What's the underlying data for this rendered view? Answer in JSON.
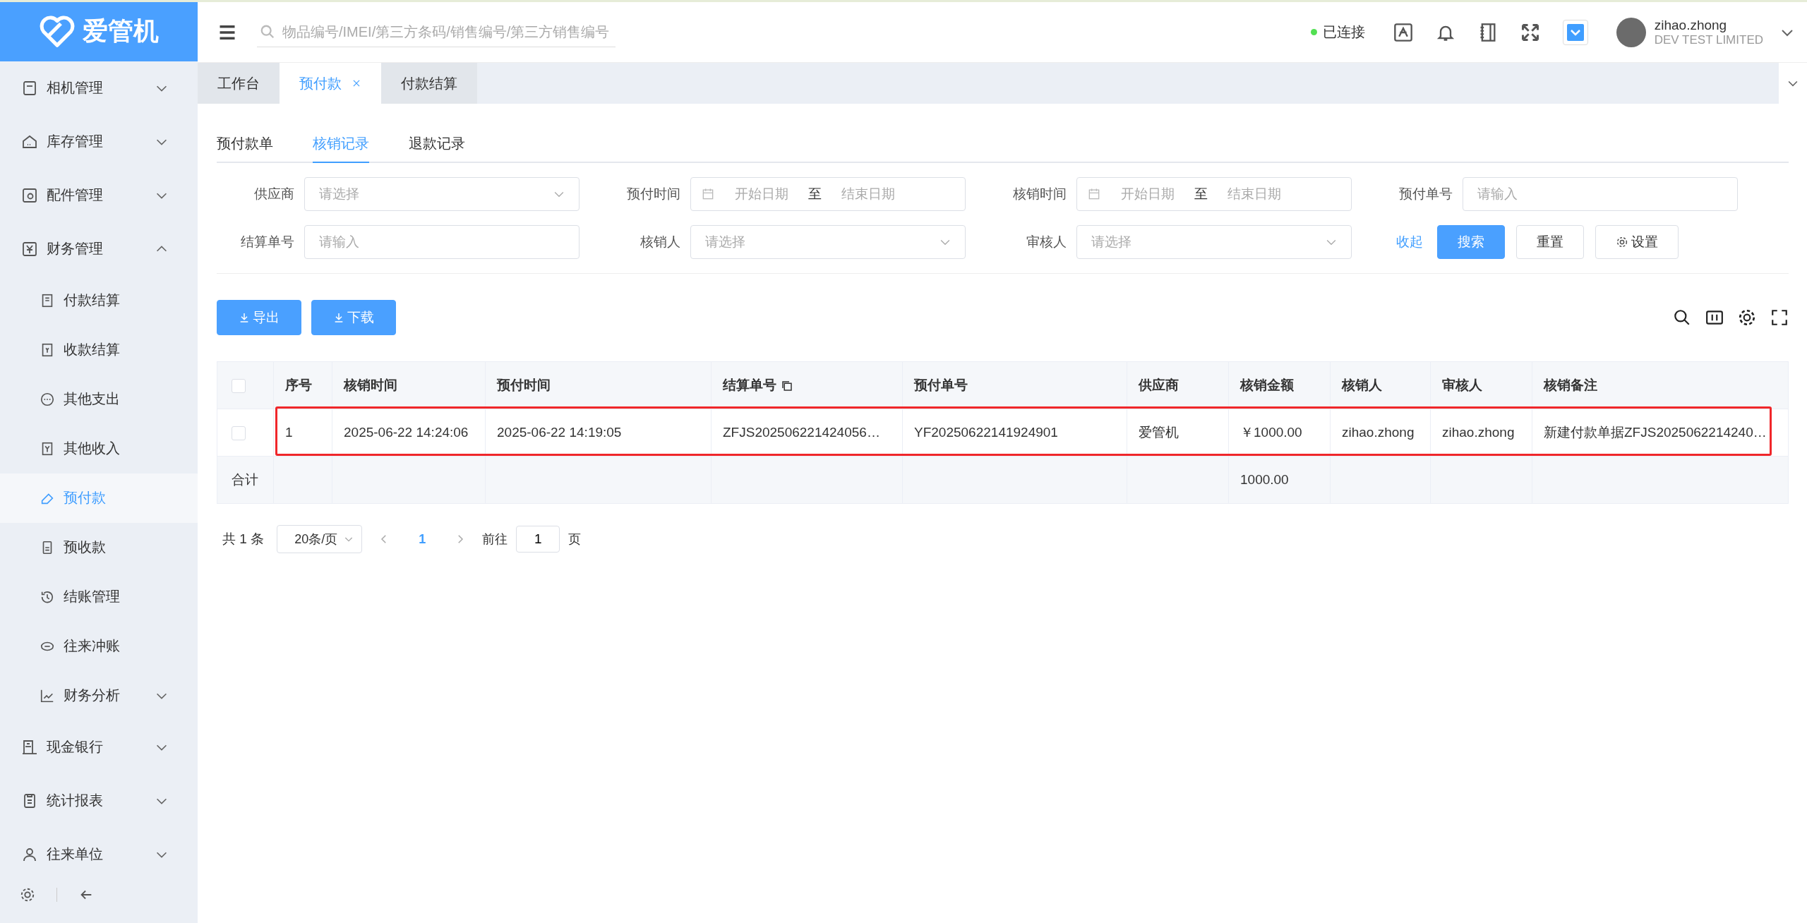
{
  "logo": {
    "text": "爱管机"
  },
  "search": {
    "placeholder": "物品编号/IMEI/第三方条码/销售编号/第三方销售编号"
  },
  "header": {
    "status": "已连接",
    "connected": true,
    "user": {
      "name": "zihao.zhong",
      "company": "DEV TEST LIMITED"
    }
  },
  "sidebar": {
    "items": [
      {
        "label": "相机管理",
        "expanded": false,
        "selected": false
      },
      {
        "label": "库存管理",
        "expanded": false,
        "selected": false
      },
      {
        "label": "配件管理",
        "expanded": false,
        "selected": false
      },
      {
        "label": "财务管理",
        "expanded": true,
        "selected": false,
        "children": [
          {
            "label": "付款结算",
            "selected": false
          },
          {
            "label": "收款结算",
            "selected": false
          },
          {
            "label": "其他支出",
            "selected": false
          },
          {
            "label": "其他收入",
            "selected": false
          },
          {
            "label": "预付款",
            "selected": true
          },
          {
            "label": "预收款",
            "selected": false
          },
          {
            "label": "结账管理",
            "selected": false
          },
          {
            "label": "往来冲账",
            "selected": false
          },
          {
            "label": "财务分析",
            "selected": false,
            "expanded": false
          }
        ]
      },
      {
        "label": "现金银行",
        "expanded": false,
        "selected": false
      },
      {
        "label": "统计报表",
        "expanded": false,
        "selected": false
      },
      {
        "label": "往来单位",
        "expanded": false,
        "selected": false
      }
    ]
  },
  "page_tabs": [
    {
      "label": "工作台",
      "selected": false,
      "closable": false
    },
    {
      "label": "预付款",
      "selected": true,
      "closable": true
    },
    {
      "label": "付款结算",
      "selected": false,
      "closable": false
    }
  ],
  "sub_tabs": [
    {
      "label": "预付款单",
      "selected": false
    },
    {
      "label": "核销记录",
      "selected": true
    },
    {
      "label": "退款记录",
      "selected": false
    }
  ],
  "filters": [
    {
      "kind": "select",
      "label": "供应商",
      "placeholder": "请选择"
    },
    {
      "kind": "daterange",
      "label": "预付时间",
      "start": "开始日期",
      "sep": "至",
      "end": "结束日期"
    },
    {
      "kind": "daterange",
      "label": "核销时间",
      "start": "开始日期",
      "sep": "至",
      "end": "结束日期"
    },
    {
      "kind": "input",
      "label": "预付单号",
      "placeholder": "请输入"
    },
    {
      "kind": "input",
      "label": "结算单号",
      "placeholder": "请输入"
    },
    {
      "kind": "select",
      "label": "核销人",
      "placeholder": "请选择"
    },
    {
      "kind": "select",
      "label": "审核人",
      "placeholder": "请选择"
    }
  ],
  "filter_actions": {
    "collapse": "收起",
    "search": "搜索",
    "reset": "重置",
    "settings": "设置"
  },
  "toolbar": {
    "buttons": [
      "导出",
      "下载"
    ]
  },
  "table": {
    "columns": [
      "序号",
      "核销时间",
      "预付时间",
      "结算单号",
      "预付单号",
      "供应商",
      "核销金额",
      "核销人",
      "审核人",
      "核销备注"
    ],
    "header_checked": false,
    "rows": [
      {
        "checked": false,
        "highlighted": true,
        "cells": [
          "1",
          "2025-06-22 14:24:06",
          "2025-06-22 14:19:05",
          "ZFJS202506221424056…",
          "YF20250622141924901",
          "爱管机",
          "￥1000.00",
          "zihao.zhong",
          "zihao.zhong",
          "新建付款单据ZFJS2025062214240…"
        ]
      }
    ],
    "summary": {
      "label": "合计",
      "amount": "1000.00"
    }
  },
  "pagination": {
    "total": "共 1 条",
    "page_size": "20条/页",
    "pages": [
      {
        "label": "1",
        "selected": true
      }
    ],
    "goto_label": "前往",
    "goto_value": "1",
    "goto_suffix": "页"
  }
}
